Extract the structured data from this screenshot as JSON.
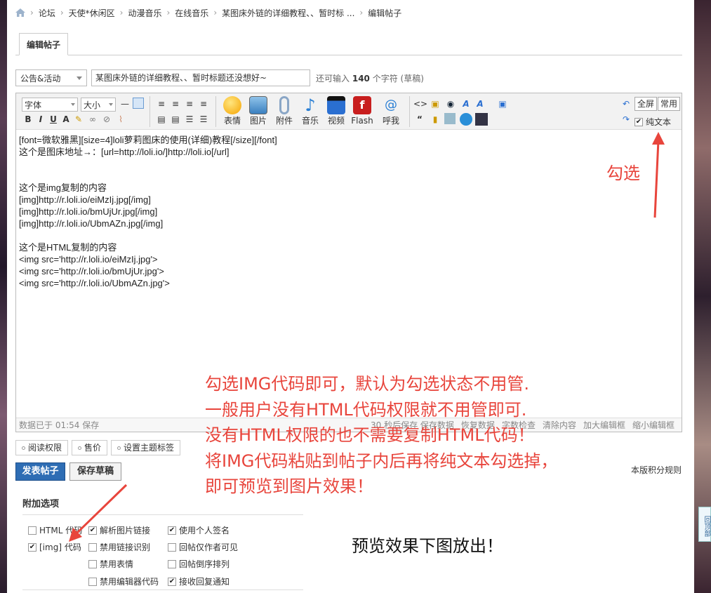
{
  "breadcrumb": [
    "论坛",
    "天使*休闲区",
    "动漫音乐",
    "在线音乐",
    "某图床外链的详细教程、、暂时标 ...",
    "编辑帖子"
  ],
  "tab": {
    "label": "编辑帖子"
  },
  "form": {
    "category": "公告&活动",
    "title": "某图床外链的详细教程、、暂时标题还没想好~",
    "hint_prefix": "还可输入",
    "hint_count": "140",
    "hint_suffix": "个字符 (草稿)"
  },
  "toolbar": {
    "font_label": "字体",
    "size_label": "大小",
    "big_buttons": [
      "表情",
      "图片",
      "附件",
      "音乐",
      "视频",
      "Flash",
      "呼我"
    ],
    "fullscreen": "全屏",
    "common": "常用",
    "plaintext": "纯文本"
  },
  "editor_content": "[font=微软雅黑][size=4]loli萝莉图床的使用(详细)教程[/size][/font]\n这个是图床地址→：[url=http://loli.io/]http://loli.io[/url]\n\n\n这个是img复制的内容\n[img]http://r.loli.io/eiMzIj.jpg[/img]\n[img]http://r.loli.io/bmUjUr.jpg[/img]\n[img]http://r.loli.io/UbmAZn.jpg[/img]\n\n这个是HTML复制的内容\n<img src='http://r.loli.io/eiMzIj.jpg'>\n<img src='http://r.loli.io/bmUjUr.jpg'>\n<img src='http://r.loli.io/UbmAZn.jpg'>",
  "statusbar": {
    "saved": "数据已于 01:54 保存",
    "actions": [
      "30 秒后保存 保存数据",
      "恢复数据",
      "字数检查",
      "清除内容",
      "加大编辑框",
      "缩小编辑框"
    ]
  },
  "extras": [
    "阅读权限",
    "售价",
    "设置主题标签"
  ],
  "buttons": {
    "post": "发表帖子",
    "draft": "保存草稿",
    "rules": "本版积分规则"
  },
  "options": {
    "title": "附加选项",
    "items": [
      {
        "label": "HTML 代码",
        "checked": false
      },
      {
        "label": "解析图片链接",
        "checked": true
      },
      {
        "label": "使用个人签名",
        "checked": true
      },
      {
        "label": "[img] 代码",
        "checked": true
      },
      {
        "label": "禁用链接识别",
        "checked": false
      },
      {
        "label": "回帖仅作者可见",
        "checked": false
      },
      {
        "label": "禁用表情",
        "checked": false
      },
      {
        "label": "回帖倒序排列",
        "checked": false
      },
      {
        "label": "禁用编辑器代码",
        "checked": false
      },
      {
        "label": "接收回复通知",
        "checked": true
      }
    ]
  },
  "annotations": {
    "check": "勾选",
    "lines": [
      "勾选IMG代码即可，默认为勾选状态不用管.",
      "一般用户没有HTML代码权限就不用管即可.",
      "没有HTML权限的也不需要复制HTML代码！",
      "将IMG代码粘贴到帖子内后再将纯文本勾选掉，",
      "即可预览到图片效果！"
    ],
    "preview": "预览效果下图放出！"
  },
  "backtop": "回顶部",
  "colors": {
    "annotation": "#e8453c",
    "post_button": "#2e6db4"
  }
}
